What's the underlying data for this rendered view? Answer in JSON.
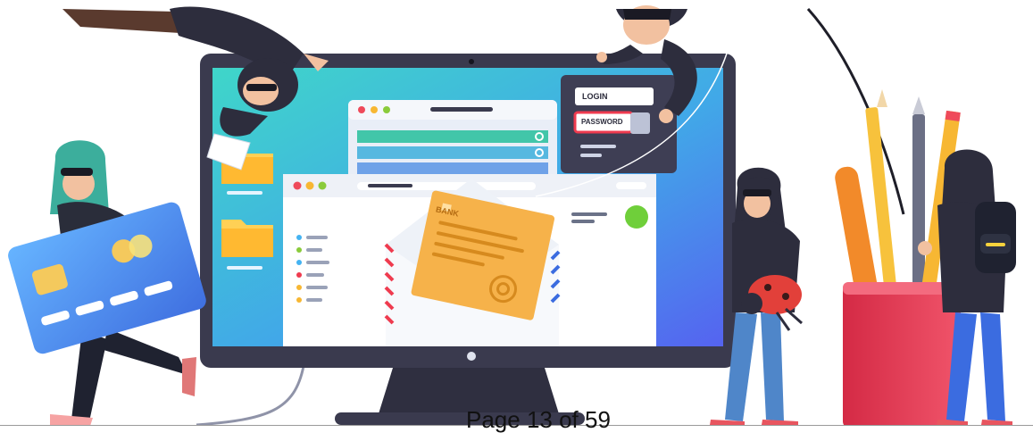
{
  "illustration": {
    "login_label": "LOGIN",
    "password_label": "PASSWORD",
    "bank_label": "BANK",
    "icons": [
      "credit-card-icon",
      "envelope-icon",
      "folder-icon",
      "key-icon",
      "bug-icon",
      "pencil-cup-icon"
    ]
  },
  "footer": {
    "page_number": "Page 13 of 59"
  },
  "colors": {
    "screen_gradient_start": "#3fd6c9",
    "screen_gradient_end": "#4b6cf2",
    "monitor_frame": "#3a3a4e",
    "hacker_hood": "#2d2d3d",
    "card_blue": "#4f8ff0",
    "letter_orange": "#f6b24a",
    "cup_red": "#e8364f"
  }
}
